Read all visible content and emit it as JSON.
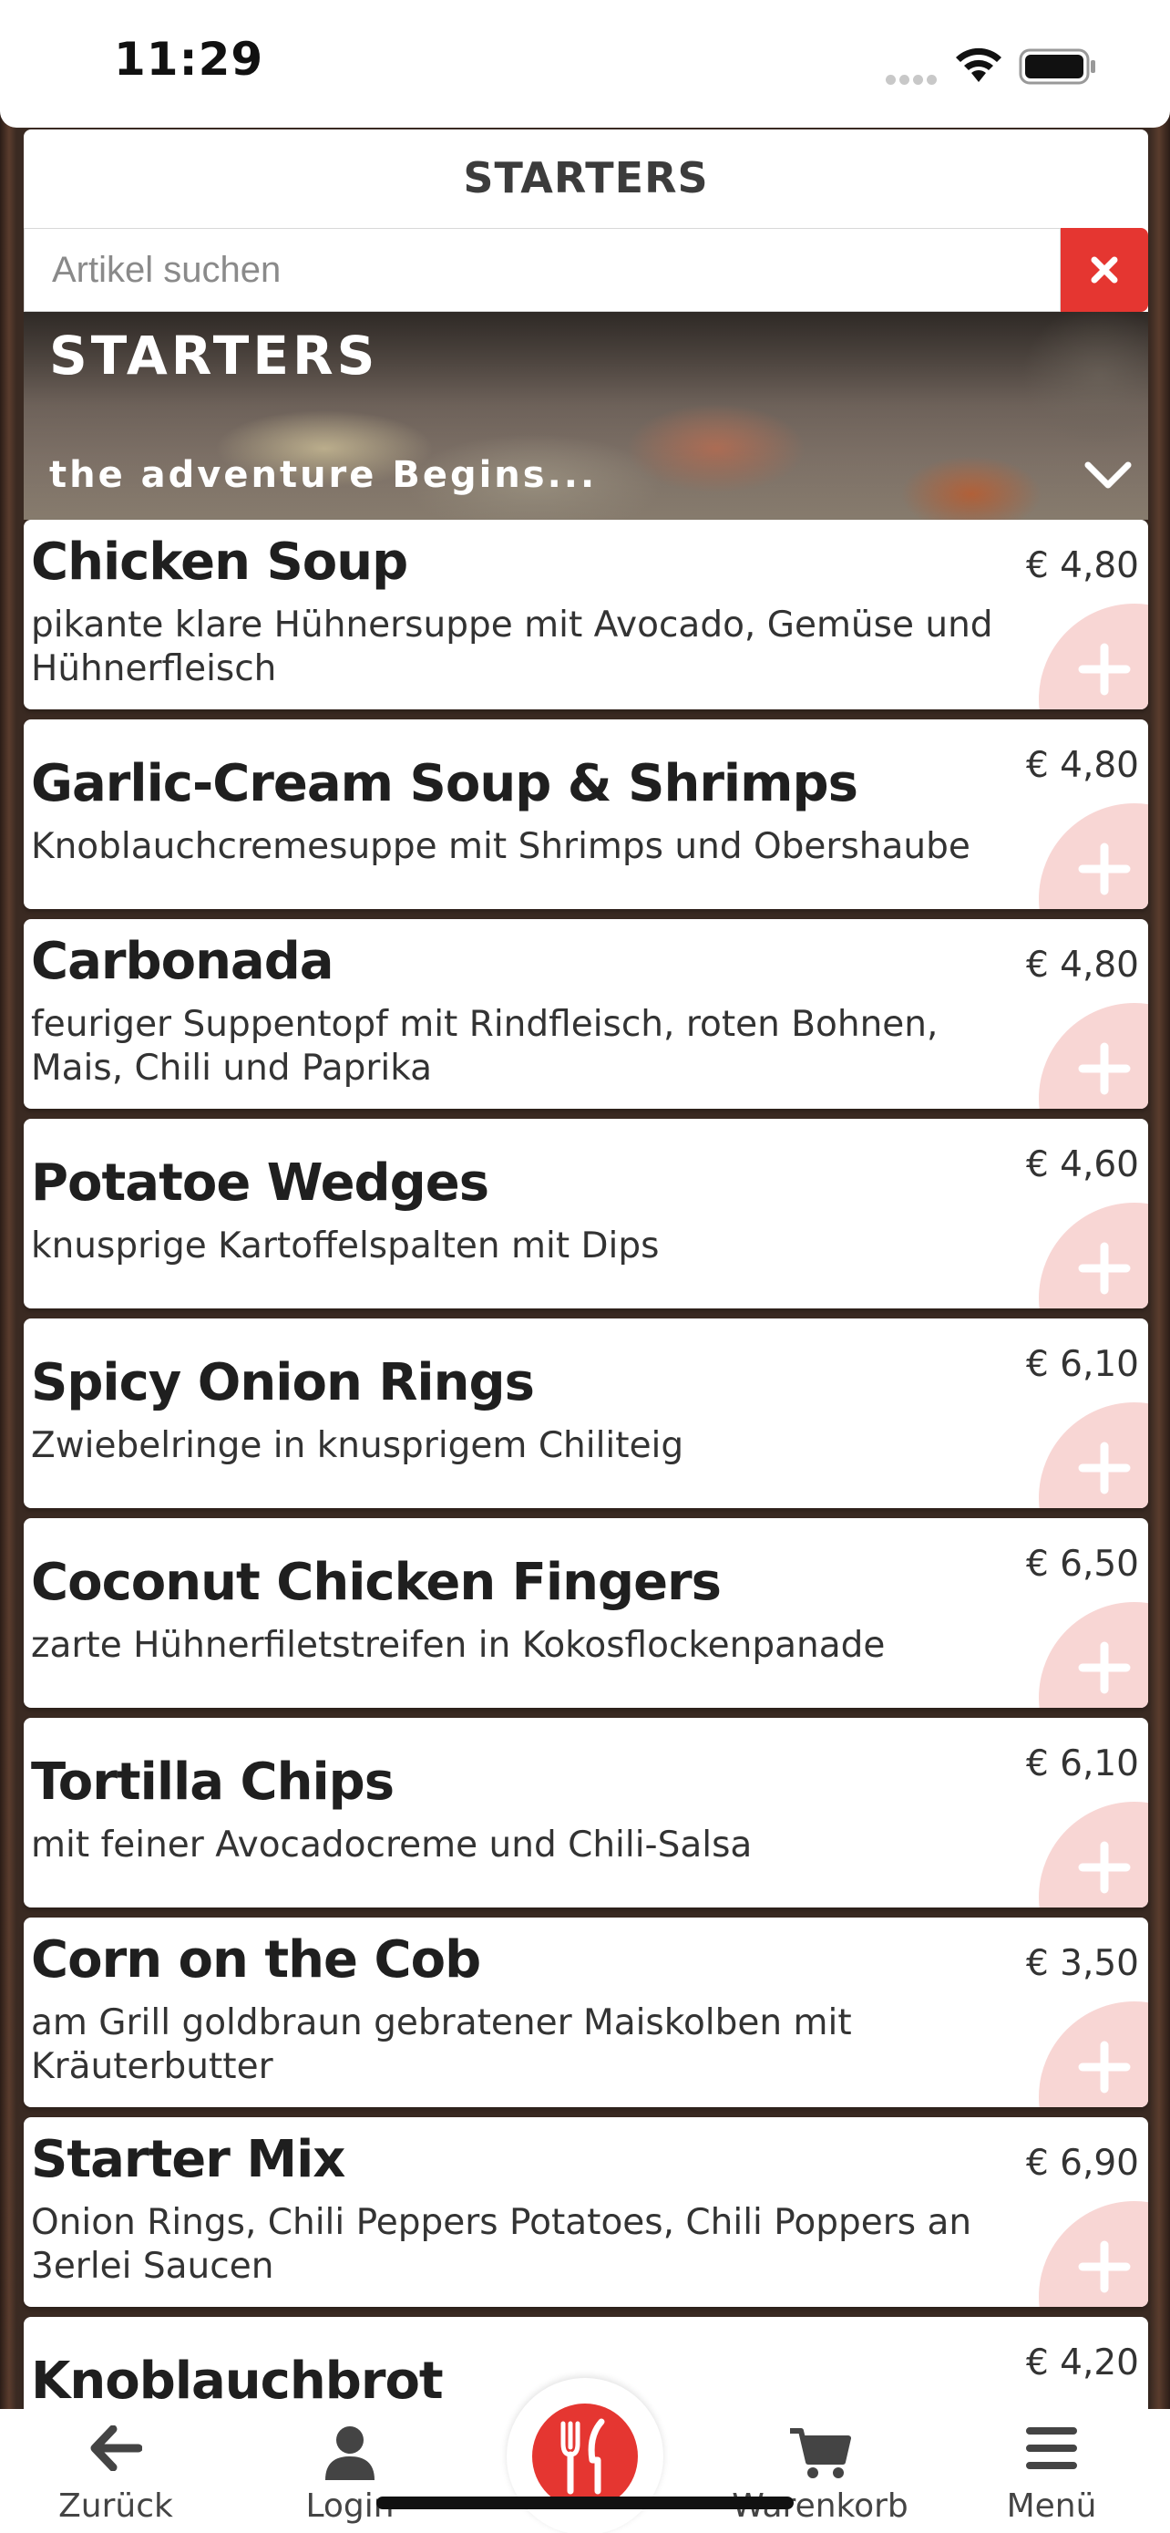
{
  "status_bar": {
    "time": "11:29"
  },
  "header": {
    "title": "STARTERS"
  },
  "search": {
    "placeholder": "Artikel suchen",
    "clear_symbol": "×"
  },
  "banner": {
    "title": "STARTERS",
    "subtitle": "the adventure Begins..."
  },
  "items": [
    {
      "name": "Chicken Soup",
      "description": "pikante klare Hühnersuppe mit Avocado, Gemüse und Hühnerfleisch",
      "price": "€ 4,80"
    },
    {
      "name": "Garlic-Cream Soup & Shrimps",
      "description": "Knoblauchcremesuppe mit Shrimps und Obershaube",
      "price": "€ 4,80"
    },
    {
      "name": "Carbonada",
      "description": "feuriger Suppentopf mit Rindfleisch, roten Bohnen, Mais, Chili und Paprika",
      "price": "€ 4,80"
    },
    {
      "name": "Potatoe Wedges",
      "description": "knusprige Kartoffelspalten mit Dips",
      "price": "€ 4,60"
    },
    {
      "name": "Spicy Onion Rings",
      "description": "Zwiebelringe in knusprigem Chiliteig",
      "price": "€ 6,10"
    },
    {
      "name": "Coconut Chicken Fingers",
      "description": "zarte Hühnerfiletstreifen in Kokosflockenpanade",
      "price": "€ 6,50"
    },
    {
      "name": "Tortilla Chips",
      "description": "mit feiner Avocadocreme und Chili-Salsa",
      "price": "€ 6,10"
    },
    {
      "name": "Corn on the Cob",
      "description": "am Grill goldbraun gebratener Maiskolben mit Kräuterbutter",
      "price": "€ 3,50"
    },
    {
      "name": "Starter Mix",
      "description": "Onion Rings, Chili Peppers Potatoes, Chili Poppers an 3erlei Saucen",
      "price": "€ 6,90"
    },
    {
      "name": "Knoblauchbrot",
      "description": "",
      "price": "€ 4,20"
    }
  ],
  "bottom_nav": {
    "back": "Zurück",
    "login": "Login",
    "cart": "Warenkorb",
    "menu": "Menü"
  },
  "colors": {
    "accent": "#e53631",
    "add_button_bg": "#f8d6d4"
  },
  "icons": {
    "back": "arrow-left-icon",
    "login": "user-icon",
    "center": "fork-knife-icon",
    "cart": "cart-icon",
    "menu": "hamburger-icon",
    "add": "plus-icon",
    "banner_toggle": "chevron-down-icon"
  }
}
